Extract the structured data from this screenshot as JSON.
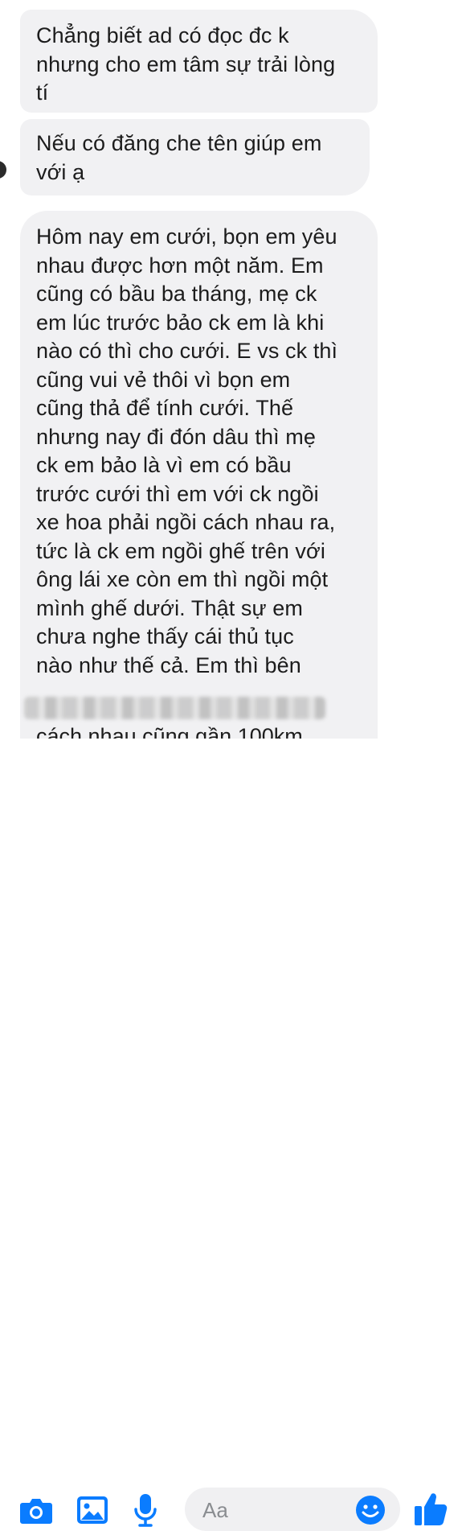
{
  "messages": [
    {
      "text": "Chẳng biết ad có đọc đc k\nnhưng cho em tâm sự trải lòng\ntí"
    },
    {
      "text": "Nếu có đăng che tên giúp em\nvới ạ"
    },
    {
      "text": "Hôm nay em cưới, bọn em yêu\nnhau được hơn một năm. Em\ncũng có bầu ba tháng, mẹ ck\nem lúc trước bảo ck em là khi\nnào có thì cho cưới. E vs ck thì\ncũng vui vẻ thôi vì bọn em\ncũng thả để tính cưới. Thế\nnhưng nay đi đón dâu thì mẹ\nck em bảo là vì em có bầu\ntrước cưới thì em với ck ngồi\nxe hoa phải ngồi cách nhau ra,\ntức là ck em ngồi ghế trên với\nông lái xe còn em thì ngồi một\nmình ghế dưới. Thật sự em\nchưa nghe thấy cái thủ tục\nnào như thế cả. Em thì bên"
    }
  ],
  "partial_line": "cách nhau cũng gần 100km",
  "composer": {
    "placeholder": "Aa",
    "icons": [
      "camera-icon",
      "gallery-icon",
      "microphone-icon",
      "emoji-icon",
      "like-icon"
    ],
    "accent": "#0a7cff"
  },
  "colors": {
    "bubble": "#f1f1f3",
    "text": "#1c1c1c"
  }
}
